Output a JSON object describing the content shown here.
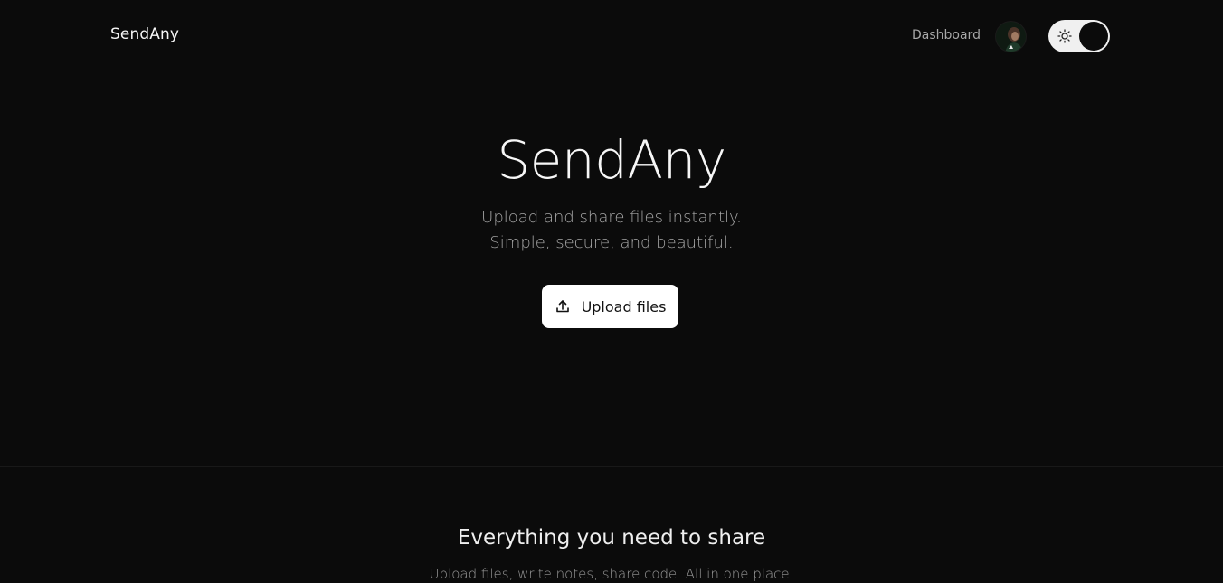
{
  "header": {
    "brand": "SendAny",
    "nav": {
      "dashboard_label": "Dashboard"
    },
    "avatar_icon": "user-avatar",
    "theme_toggle_icon": "sun-icon"
  },
  "hero": {
    "title": "SendAny",
    "subtitle_line1": "Upload and share files instantly.",
    "subtitle_line2": "Simple, secure, and beautiful.",
    "upload_button_label": "Upload files",
    "upload_button_icon": "upload-icon"
  },
  "features": {
    "title": "Everything you need to share",
    "subtitle": "Upload files, write notes, share code. All in one place."
  },
  "colors": {
    "background": "#0b0b0b",
    "text_primary": "#f2f2f2",
    "text_muted": "#a6a6a6",
    "button_bg": "#ffffff",
    "toggle_track": "#f0f0f0"
  }
}
